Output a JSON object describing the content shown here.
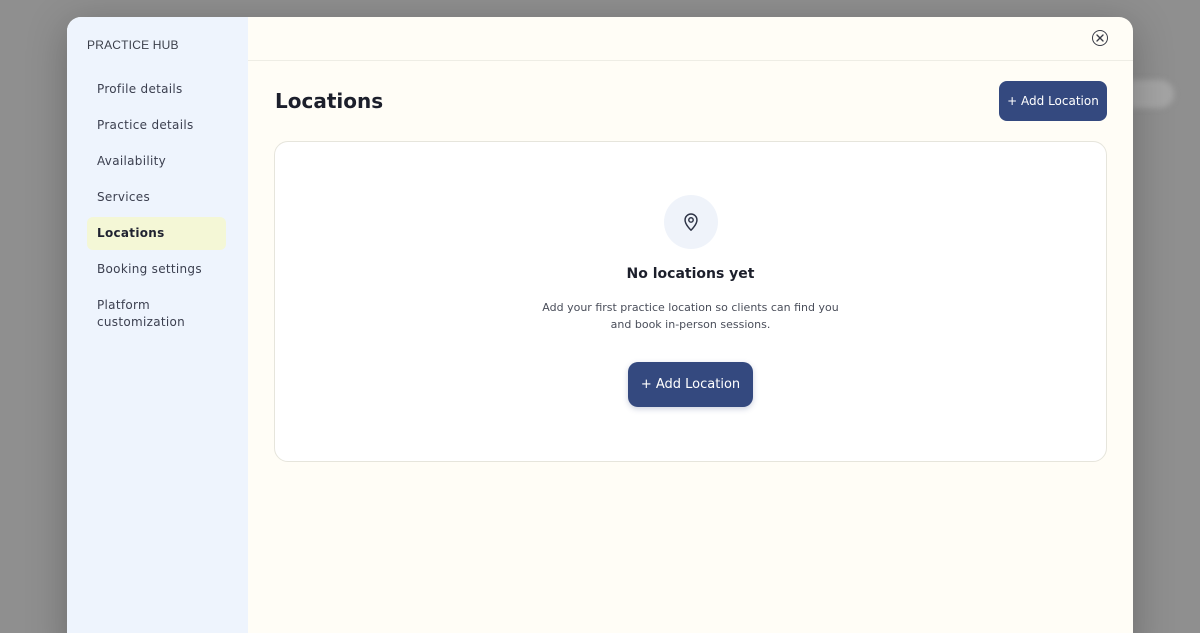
{
  "sidebar": {
    "title": "PRACTICE HUB",
    "items": [
      {
        "label": "Profile details",
        "active": false
      },
      {
        "label": "Practice details",
        "active": false
      },
      {
        "label": "Availability",
        "active": false
      },
      {
        "label": "Services",
        "active": false
      },
      {
        "label": "Locations",
        "active": true
      },
      {
        "label": "Booking settings",
        "active": false
      },
      {
        "label": "Platform customization",
        "active": false
      }
    ]
  },
  "main": {
    "title": "Locations",
    "add_button_label": "+ Add Location",
    "close_icon": "close-circle-icon",
    "empty_state": {
      "icon": "map-pin-icon",
      "title": "No locations yet",
      "description_line1": "Add your first practice location so clients can find you",
      "description_line2": "and book in-person sessions.",
      "button_label": "+ Add Location"
    }
  },
  "colors": {
    "primary_button": "#34497f",
    "sidebar_bg": "#eef4fd",
    "active_item_bg": "#f4f7d6",
    "main_bg": "#fffdf6",
    "overlay": "#8f8f8f"
  }
}
